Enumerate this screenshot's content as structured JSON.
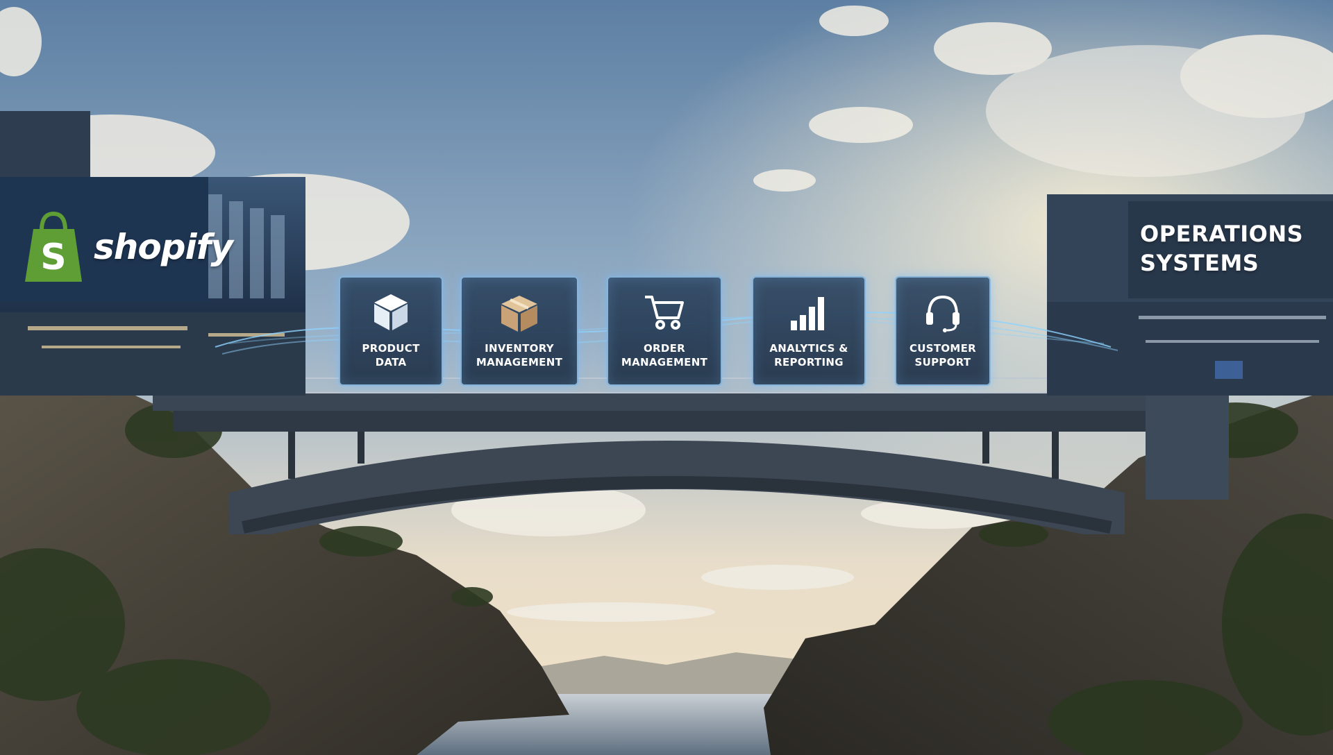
{
  "brand": {
    "name": "shopify",
    "icon": "shopping-bag-icon",
    "icon_letter": "S",
    "color": "#5e9e34"
  },
  "operations_sign": "OPERATIONS\nSYSTEMS",
  "modules": [
    {
      "label": "PRODUCT\nDATA",
      "icon": "cube-icon"
    },
    {
      "label": "INVENTORY\nMANAGEMENT",
      "icon": "package-box-icon"
    },
    {
      "label": "ORDER\nMANAGEMENT",
      "icon": "shopping-cart-icon"
    },
    {
      "label": "ANALYTICS &\nREPORTING",
      "icon": "bar-chart-icon"
    },
    {
      "label": "CUSTOMER\nSUPPORT",
      "icon": "headset-icon"
    }
  ],
  "colors": {
    "data_stream": "#8fd3ff",
    "panel_border": "#a6cdf0"
  }
}
